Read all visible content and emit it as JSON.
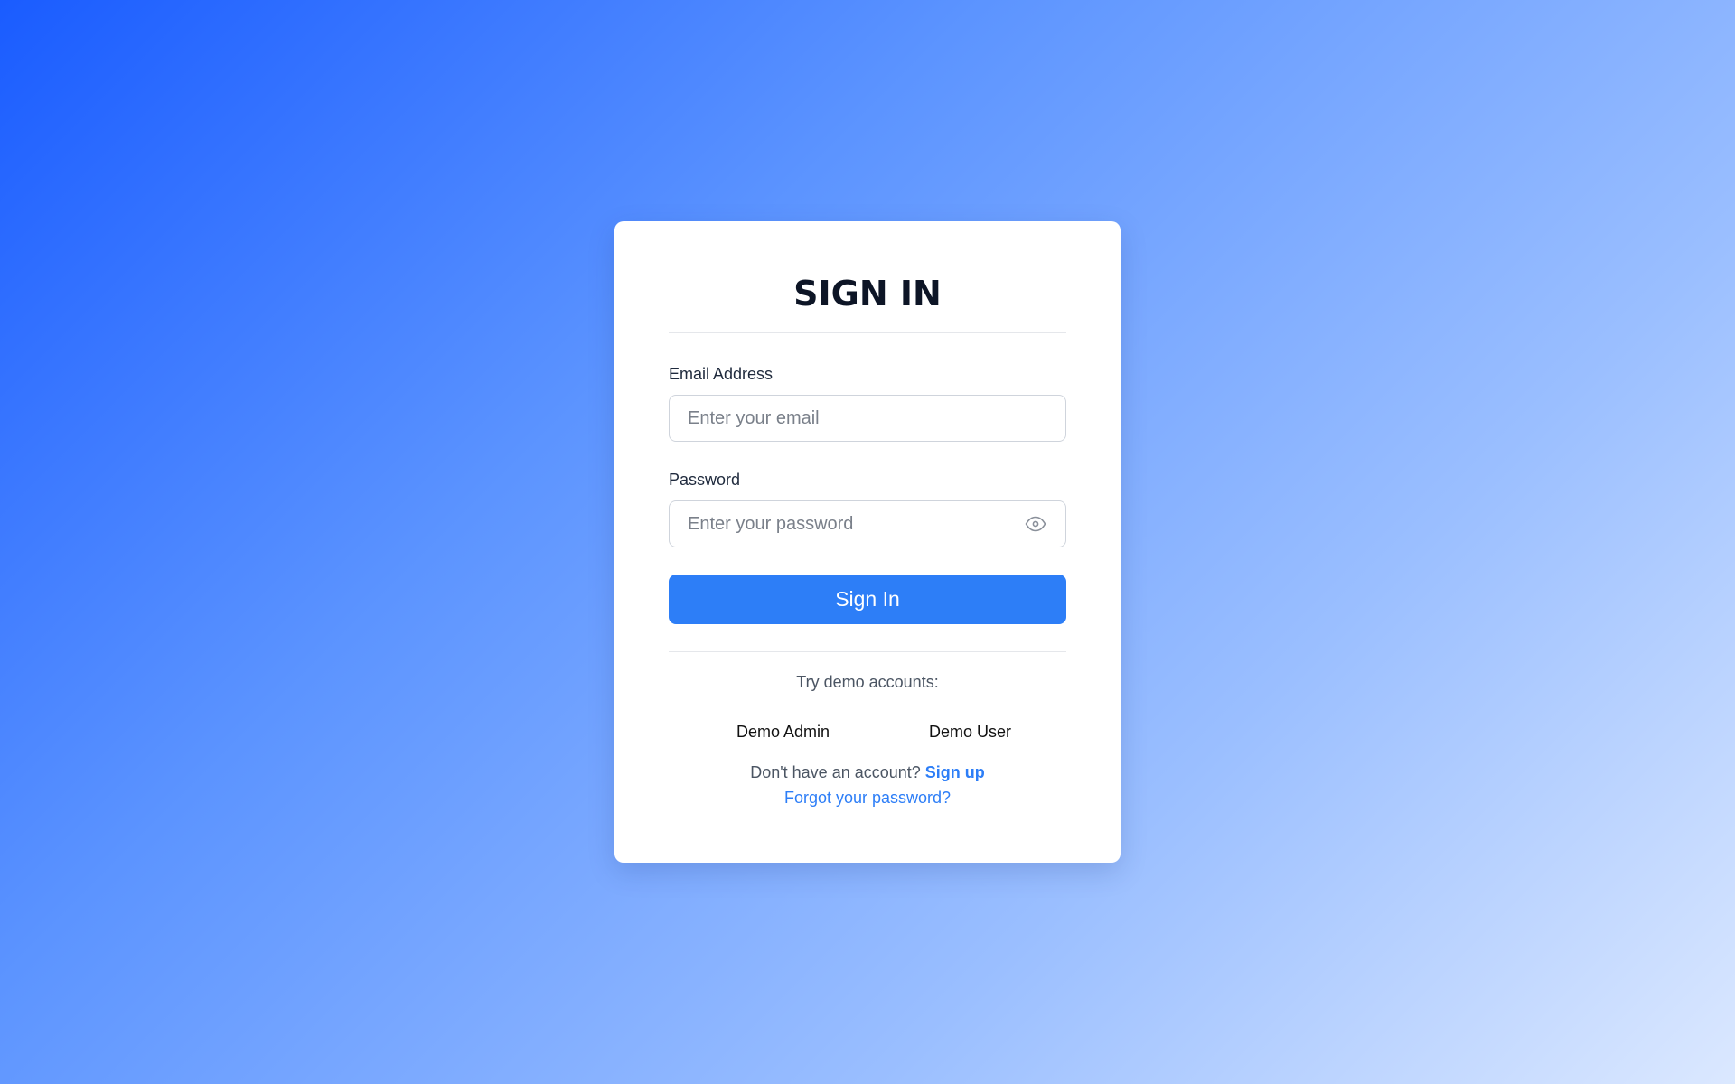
{
  "card": {
    "title": "SIGN IN"
  },
  "email": {
    "label": "Email Address",
    "placeholder": "Enter your email",
    "value": ""
  },
  "password": {
    "label": "Password",
    "placeholder": "Enter your password",
    "value": "",
    "toggle_icon": "eye-icon"
  },
  "signin_button": {
    "label": "Sign In"
  },
  "demo": {
    "caption": "Try demo accounts:",
    "accounts": [
      "Demo Admin",
      "Demo User"
    ]
  },
  "footer": {
    "signup_prompt": "Don't have an account?",
    "signup_link": "Sign up",
    "forgot_link": "Forgot your password?"
  },
  "colors": {
    "accent": "#2d7ef7",
    "title": "#0d1526",
    "background_start": "#1a5cff",
    "background_end": "#dbe8ff"
  }
}
